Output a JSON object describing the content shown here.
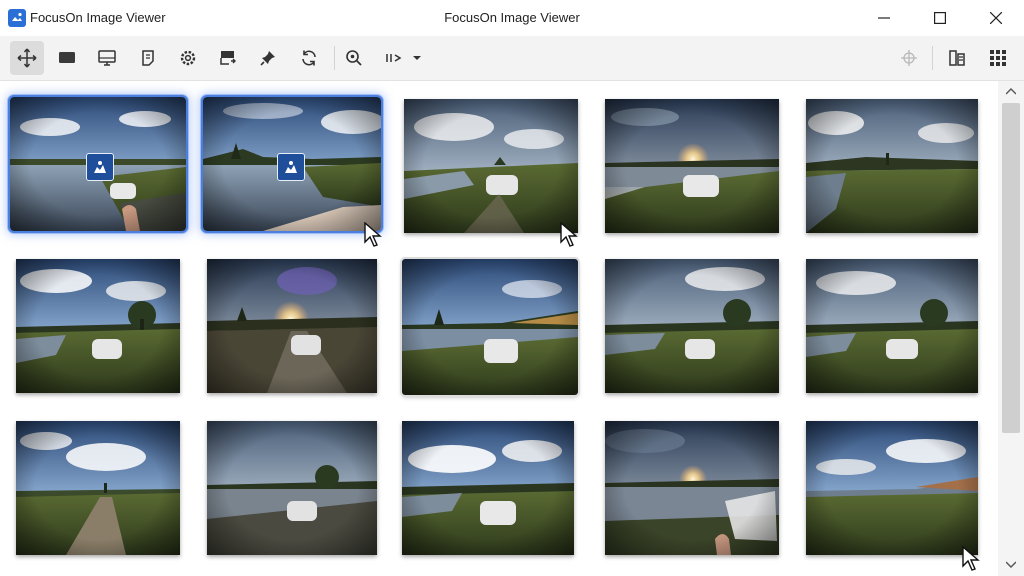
{
  "window": {
    "app_title": "FocusOn Image Viewer",
    "center_title": "FocusOn Image Viewer"
  },
  "toolbar": {
    "left_icons": [
      "pan-move-icon",
      "slideshow-icon",
      "monitor-icon",
      "notes-icon",
      "settings-gear-icon",
      "export-icon",
      "pin-icon",
      "refresh-icon",
      "zoom-icon",
      "sort-icon"
    ],
    "right_icons": [
      "crosshair-icon",
      "compare-icon",
      "grid-view-icon"
    ]
  },
  "colors": {
    "selection": "#4a7fe0",
    "badge": "#1f4f9a",
    "toolbar_bg": "#f3f3f3"
  },
  "gallery": {
    "rows": 3,
    "columns": 5,
    "selected": [
      1,
      2
    ],
    "hovered": [
      8
    ]
  }
}
